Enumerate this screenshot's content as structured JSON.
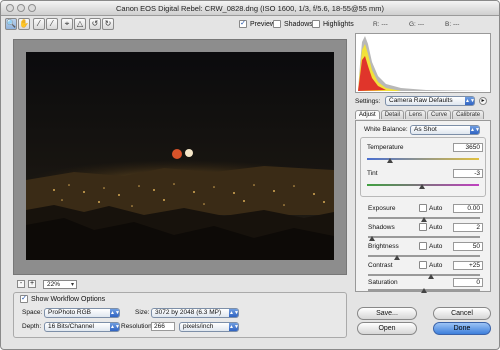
{
  "window": {
    "title": "Canon EOS Digital Rebel:  CRW_0828.dng  (ISO 1600, 1/3, f/5.6, 18-55@55 mm)"
  },
  "toolbar": {
    "tools": [
      "zoom-tool",
      "hand-tool",
      "white-balance-tool",
      "color-sampler-tool",
      "crop-tool",
      "straighten-tool",
      "rotate-left-tool",
      "rotate-right-tool"
    ],
    "preview_label": "Preview",
    "preview_checked": true,
    "shadows_label": "Shadows",
    "highlights_label": "Highlights",
    "r_label": "R:",
    "g_label": "G:",
    "b_label": "B:",
    "r_value": "---",
    "g_value": "---",
    "b_value": "---"
  },
  "zoom": {
    "minus": "-",
    "plus": "+",
    "value": "22%"
  },
  "workflow": {
    "show_label": "Show Workflow Options",
    "space_label": "Space:",
    "space_value": "ProPhoto RGB",
    "depth_label": "Depth:",
    "depth_value": "16 Bits/Channel",
    "size_label": "Size:",
    "size_value": "3072 by 2048  (6.3 MP)",
    "resolution_label": "Resolution:",
    "resolution_value": "266",
    "resolution_unit": "pixels/inch"
  },
  "settings": {
    "label": "Settings:",
    "value": "Camera Raw Defaults"
  },
  "tabs": [
    "Adjust",
    "Detail",
    "Lens",
    "Curve",
    "Calibrate"
  ],
  "adjust": {
    "wb_label": "White Balance:",
    "wb_value": "As Shot",
    "temperature_label": "Temperature",
    "temperature_value": "3650",
    "tint_label": "Tint",
    "tint_value": "-3",
    "exposure_label": "Exposure",
    "exposure_value": "0.00",
    "shadows_label": "Shadows",
    "shadows_value": "2",
    "brightness_label": "Brightness",
    "brightness_value": "50",
    "contrast_label": "Contrast",
    "contrast_value": "+25",
    "saturation_label": "Saturation",
    "saturation_value": "0",
    "auto_label": "Auto"
  },
  "buttons": {
    "save": "Save...",
    "cancel": "Cancel",
    "open": "Open",
    "done": "Done"
  },
  "colors": {
    "accent": "#3d7fdb",
    "histogram_yellow": "#f2e23a",
    "histogram_red": "#e0352b"
  }
}
